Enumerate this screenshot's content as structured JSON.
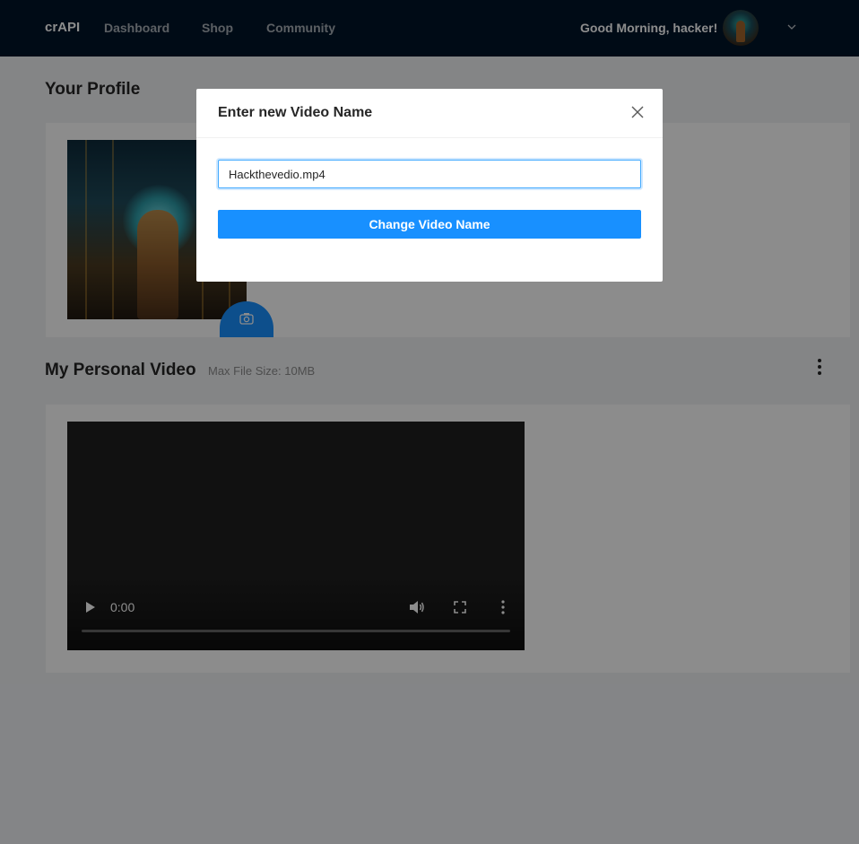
{
  "header": {
    "brand": "crAPI",
    "nav": [
      "Dashboard",
      "Shop",
      "Community"
    ],
    "greeting": "Good Morning, hacker!",
    "avatar_icon": "user-avatar",
    "dropdown_icon": "chevron-down-icon"
  },
  "profile": {
    "title": "Your Profile",
    "camera_icon": "camera-icon"
  },
  "video_section": {
    "title": "My Personal Video",
    "hint": "Max File Size: 10MB",
    "more_icon": "more-vertical-icon",
    "player": {
      "time": "0:00",
      "controls": [
        "play-icon",
        "volume-icon",
        "fullscreen-icon",
        "more-vertical-icon"
      ]
    }
  },
  "modal": {
    "title": "Enter new Video Name",
    "input_value": "Hackthevedio.mp4",
    "button_label": "Change Video Name",
    "close_icon": "close-icon"
  },
  "colors": {
    "header_bg": "#001529",
    "primary": "#1890ff",
    "page_bg": "#f0f2f5",
    "overlay": "rgba(0,0,0,0.45)"
  }
}
